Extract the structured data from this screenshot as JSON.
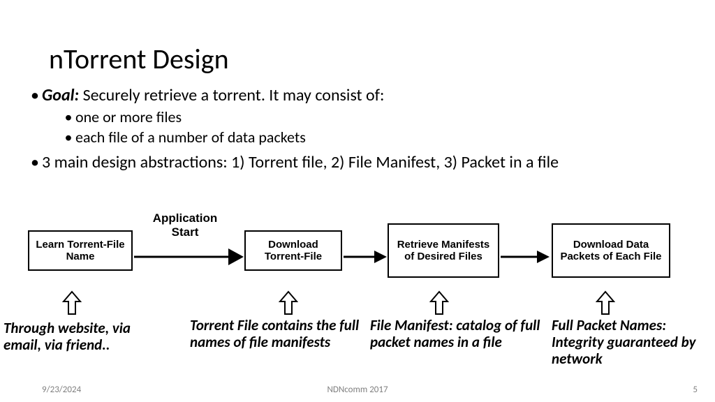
{
  "title": "nTorrent Design",
  "goal_label": "Goal:",
  "goal_text": " Securely retrieve a torrent. It may consist of:",
  "sub1": "one or more files",
  "sub2": "each file of a number of data packets",
  "bullet2": "3 main design abstractions: 1) Torrent file, 2) File Manifest, 3) Packet in a file",
  "flow": {
    "app_start": "Application Start",
    "box1": "Learn Torrent-File Name",
    "box2": "Download Torrent-File",
    "box3": "Retrieve Manifests of Desired Files",
    "box4": "Download Data Packets of Each File"
  },
  "ann": {
    "a1": "Through website, via email, via friend..",
    "a2": "Torrent File contains the full names of file manifests",
    "a3": "File Manifest: catalog of full packet names in a file",
    "a4": "Full Packet Names: Integrity guaranteed by network"
  },
  "footer": {
    "date": "9/23/2024",
    "center": "NDNcomm 2017",
    "page": "5"
  }
}
